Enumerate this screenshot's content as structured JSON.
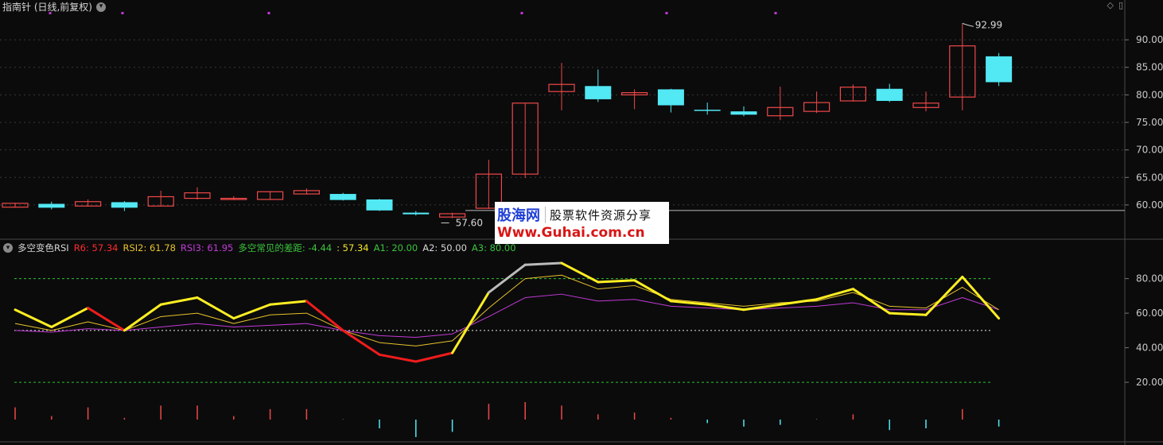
{
  "header": {
    "title": "指南针 (日线,前复权)",
    "dropdown_icon": "chevron-down-icon"
  },
  "corner": {
    "diamond_icon": "◇",
    "window_icon": "▯"
  },
  "price_axis": {
    "labels": [
      "90.00",
      "85.00",
      "80.00",
      "75.00",
      "70.00",
      "65.00",
      "60.00"
    ],
    "values": [
      90,
      85,
      80,
      75,
      70,
      65,
      60
    ]
  },
  "price_range": [
    54.5,
    95.5
  ],
  "price_annotations": {
    "high_label": "92.99",
    "high_value": 92.99,
    "low_label": "57.60",
    "low_value": 57.6,
    "baseline": 59.0
  },
  "candles": [
    {
      "o": 59.6,
      "h": 60.4,
      "l": 59.5,
      "c": 60.3
    },
    {
      "o": 60.2,
      "h": 60.6,
      "l": 59.2,
      "c": 59.5
    },
    {
      "o": 59.8,
      "h": 61.0,
      "l": 59.7,
      "c": 60.6
    },
    {
      "o": 60.5,
      "h": 60.7,
      "l": 58.9,
      "c": 59.5
    },
    {
      "o": 59.8,
      "h": 62.6,
      "l": 59.7,
      "c": 61.5
    },
    {
      "o": 61.2,
      "h": 63.2,
      "l": 61.0,
      "c": 62.2
    },
    {
      "o": 61.0,
      "h": 61.6,
      "l": 60.9,
      "c": 61.2
    },
    {
      "o": 61.0,
      "h": 62.5,
      "l": 60.9,
      "c": 62.4
    },
    {
      "o": 62.0,
      "h": 63.0,
      "l": 61.9,
      "c": 62.6
    },
    {
      "o": 62.0,
      "h": 62.2,
      "l": 60.8,
      "c": 60.9
    },
    {
      "o": 61.0,
      "h": 61.1,
      "l": 58.9,
      "c": 59.0
    },
    {
      "o": 58.6,
      "h": 58.9,
      "l": 58.1,
      "c": 58.3
    },
    {
      "o": 57.8,
      "h": 58.6,
      "l": 57.6,
      "c": 58.4
    },
    {
      "o": 59.4,
      "h": 68.2,
      "l": 59.3,
      "c": 65.6
    },
    {
      "o": 65.6,
      "h": 78.5,
      "l": 64.9,
      "c": 78.5
    },
    {
      "o": 80.6,
      "h": 85.8,
      "l": 77.2,
      "c": 81.9
    },
    {
      "o": 81.6,
      "h": 84.6,
      "l": 78.7,
      "c": 79.2
    },
    {
      "o": 80.0,
      "h": 81.0,
      "l": 77.4,
      "c": 80.4
    },
    {
      "o": 81.0,
      "h": 81.1,
      "l": 76.8,
      "c": 78.1
    },
    {
      "o": 77.3,
      "h": 78.6,
      "l": 76.4,
      "c": 77.1
    },
    {
      "o": 77.0,
      "h": 77.9,
      "l": 76.1,
      "c": 76.4
    },
    {
      "o": 76.2,
      "h": 81.5,
      "l": 75.4,
      "c": 77.7
    },
    {
      "o": 77.0,
      "h": 80.6,
      "l": 76.7,
      "c": 78.6
    },
    {
      "o": 78.9,
      "h": 81.9,
      "l": 78.8,
      "c": 81.4
    },
    {
      "o": 81.1,
      "h": 82.0,
      "l": 78.7,
      "c": 78.9
    },
    {
      "o": 77.7,
      "h": 80.6,
      "l": 77.0,
      "c": 78.5
    },
    {
      "o": 79.6,
      "h": 92.99,
      "l": 77.2,
      "c": 88.9
    },
    {
      "o": 87.0,
      "h": 87.6,
      "l": 81.6,
      "c": 82.3
    }
  ],
  "indicator": {
    "name": "多空变色RSI",
    "items": [
      {
        "label": "R6: 57.34",
        "color": "#ff2a2a"
      },
      {
        "label": "RSI2: 61.78",
        "color": "#e7c22a"
      },
      {
        "label": "RSI3: 61.95",
        "color": "#c23ad6"
      },
      {
        "label": "多空常见的差距: -4.44",
        "color": "#3bc43b"
      },
      {
        "label": ": 57.34",
        "color": "#f2e72a"
      },
      {
        "label": "A1: 20.00",
        "color": "#3bc43b"
      },
      {
        "label": "A2: 50.00",
        "color": "#d8d8d8"
      },
      {
        "label": "A3: 80.00",
        "color": "#3bc43b"
      }
    ],
    "axis_labels": [
      "80.00",
      "60.00",
      "40.00",
      "20.00"
    ],
    "axis_values": [
      80,
      60,
      40,
      20
    ],
    "range": [
      9,
      95
    ],
    "levels": {
      "a1": 20,
      "a2": 50,
      "a3": 80
    },
    "r6": [
      62,
      52,
      63,
      50,
      65,
      69,
      57,
      65,
      67,
      50,
      36,
      32,
      37,
      72,
      88,
      89,
      78,
      79,
      67,
      65,
      62,
      65,
      68,
      74,
      60,
      59,
      81,
      57
    ],
    "r6_bull": [
      true,
      true,
      true,
      false,
      true,
      true,
      true,
      true,
      true,
      false,
      false,
      false,
      false,
      true,
      "peak",
      "peak",
      true,
      true,
      true,
      true,
      true,
      true,
      true,
      true,
      true,
      true,
      true,
      true
    ],
    "rsi2": [
      54,
      50,
      55,
      50,
      58,
      60,
      54,
      59,
      60,
      50,
      43,
      41,
      44,
      63,
      80,
      82,
      74,
      76,
      68,
      66,
      64,
      66,
      67,
      72,
      64,
      63,
      75,
      62
    ],
    "rsi3": [
      50,
      49,
      51,
      50,
      52,
      54,
      52,
      53,
      54,
      50,
      47,
      46,
      48,
      58,
      69,
      71,
      67,
      68,
      64,
      63,
      62,
      63,
      64,
      66,
      62,
      62,
      69,
      62
    ]
  },
  "volume": {
    "values": [
      7,
      2,
      7,
      1,
      8,
      8,
      2,
      6,
      6,
      0,
      -5,
      -10,
      -7,
      9,
      10,
      8,
      3,
      4,
      1,
      -2,
      -4,
      -3,
      0,
      3,
      -6,
      -5,
      6,
      -4
    ]
  },
  "top_markers_count": 8,
  "watermark": {
    "brand": "股海网",
    "subtitle": "股票软件资源分享",
    "url": "Www.Guhai.com.cn"
  },
  "colors": {
    "up": "#f04848",
    "down": "#52e8f4",
    "grid": "#3a3a3a",
    "axis_text": "#c8c8c8",
    "marker": "#c23ad6",
    "r6_bull": "#ffee22",
    "r6_bear": "#ee1c1c",
    "r6_peak": "#bbbbbb",
    "rsi2": "#e7c22a",
    "rsi3": "#c23ad6",
    "a_lines": "#2fc42f",
    "a2": "#e8e8e8"
  }
}
